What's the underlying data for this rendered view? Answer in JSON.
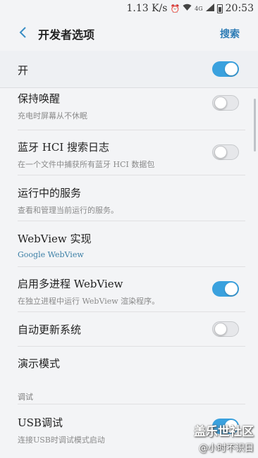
{
  "status_bar": {
    "speed": "1.13 K/s",
    "network": "4G",
    "time": "20:53"
  },
  "header": {
    "title": "开发者选项",
    "search_label": "搜索",
    "back_icon": "chevron-left-icon"
  },
  "master_switch": {
    "label": "开",
    "enabled": true
  },
  "items": [
    {
      "title": "保持唤醒",
      "subtitle": "充电时屏幕从不休眠",
      "toggle": "off"
    },
    {
      "title": "蓝牙 HCI 搜索日志",
      "subtitle": "在一个文件中捕获所有蓝牙 HCI 数据包",
      "toggle": "off"
    },
    {
      "title": "运行中的服务",
      "subtitle": "查看和管理当前运行的服务。",
      "toggle": "none"
    },
    {
      "title": "WebView 实现",
      "subtitle": "Google WebView",
      "toggle": "none"
    },
    {
      "title": "启用多进程 WebView",
      "subtitle": "在独立进程中运行 WebView 渲染程序。",
      "toggle": "on"
    },
    {
      "title": "自动更新系统",
      "subtitle": "",
      "toggle": "off"
    },
    {
      "title": "演示模式",
      "subtitle": "",
      "toggle": "none"
    }
  ],
  "section": {
    "label": "调试"
  },
  "usb": {
    "title": "USB调试",
    "subtitle": "连接USB时调试模式启动",
    "toggle": "on"
  },
  "watermark": {
    "main": "盖乐世社区",
    "sub": "@小时不识日"
  },
  "colors": {
    "accent": "#3aa1de",
    "link": "#2e7cb5",
    "background": "#f3f4f6"
  }
}
